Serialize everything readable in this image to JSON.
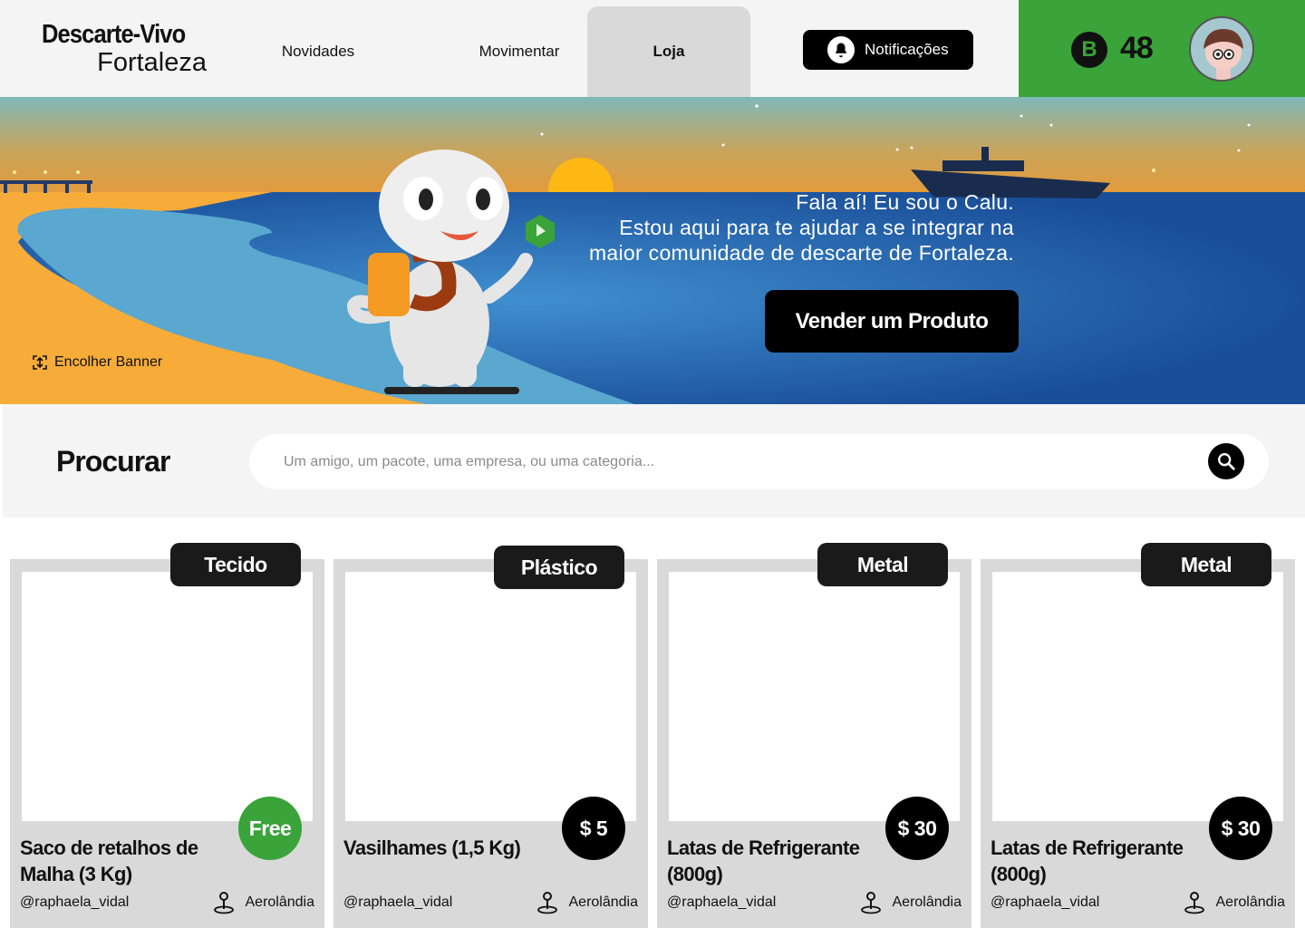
{
  "app": {
    "logo_line1": "Descarte-Vivo",
    "logo_line2": "Fortaleza"
  },
  "nav": {
    "novidades": "Novidades",
    "movimentar": "Movimentar",
    "loja": "Loja",
    "active": "Loja"
  },
  "notifications": {
    "label": "Notificações"
  },
  "wallet": {
    "coin_symbol": "B",
    "balance": "48"
  },
  "banner": {
    "line1": "Fala aí! Eu sou o Calu.",
    "line2": "Estou aqui para te ajudar a se integrar na",
    "line3": "maior comunidade de descarte de Fortaleza.",
    "sell_button": "Vender um Produto",
    "collapse": "Encolher Banner"
  },
  "search": {
    "title": "Procurar",
    "placeholder": "Um amigo, um pacote, uma empresa, ou uma categoria..."
  },
  "products": [
    {
      "category": "Tecido",
      "price": "Free",
      "title": "Saco de retalhos de Malha (3 Kg)",
      "user": "@raphaela_vidal",
      "location": "Aerolândia"
    },
    {
      "category": "Plástico",
      "price": "$ 5",
      "title": "Vasilhames  (1,5 Kg)",
      "user": "@raphaela_vidal",
      "location": "Aerolândia"
    },
    {
      "category": "Metal",
      "price": "$ 30",
      "title": "Latas de Refrigerante (800g)",
      "user": "@raphaela_vidal",
      "location": "Aerolândia"
    },
    {
      "category": "Metal",
      "price": "$ 30",
      "title": "Latas de Refrigerante (800g)",
      "user": "@raphaela_vidal",
      "location": "Aerolândia"
    }
  ],
  "colors": {
    "brand_green": "#3aa339",
    "tab_active": "#d9d9d9",
    "sea": "#1a4e99",
    "sand": "#f7ac3a"
  },
  "icons": {
    "bell": "bell-icon",
    "coin": "coin-icon",
    "search": "search-icon",
    "location": "location-pin-icon",
    "collapse": "collapse-icon"
  }
}
